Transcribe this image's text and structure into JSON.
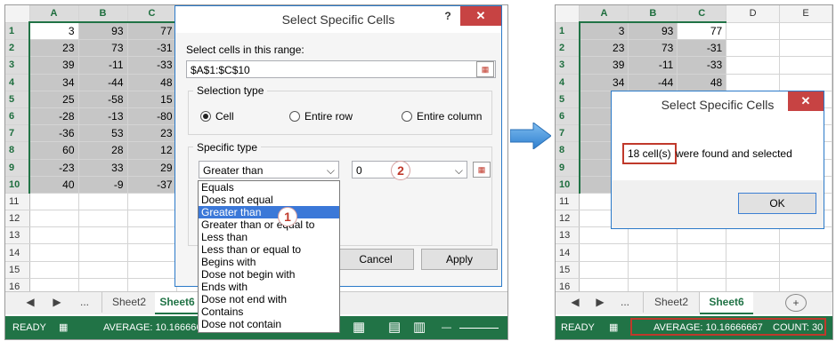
{
  "left": {
    "columns": [
      "A",
      "B",
      "C"
    ],
    "rows": [
      {
        "n": "1",
        "a": "3",
        "b": "93",
        "c": "77"
      },
      {
        "n": "2",
        "a": "23",
        "b": "73",
        "c": "-31"
      },
      {
        "n": "3",
        "a": "39",
        "b": "-11",
        "c": "-33"
      },
      {
        "n": "4",
        "a": "34",
        "b": "-44",
        "c": "48"
      },
      {
        "n": "5",
        "a": "25",
        "b": "-58",
        "c": "15"
      },
      {
        "n": "6",
        "a": "-28",
        "b": "-13",
        "c": "-80"
      },
      {
        "n": "7",
        "a": "-36",
        "b": "53",
        "c": "23"
      },
      {
        "n": "8",
        "a": "60",
        "b": "28",
        "c": "12"
      },
      {
        "n": "9",
        "a": "-23",
        "b": "33",
        "c": "29"
      },
      {
        "n": "10",
        "a": "40",
        "b": "-9",
        "c": "-37"
      },
      {
        "n": "11",
        "a": "",
        "b": "",
        "c": ""
      },
      {
        "n": "12",
        "a": "",
        "b": "",
        "c": ""
      },
      {
        "n": "13",
        "a": "",
        "b": "",
        "c": ""
      },
      {
        "n": "14",
        "a": "",
        "b": "",
        "c": ""
      },
      {
        "n": "15",
        "a": "",
        "b": "",
        "c": ""
      },
      {
        "n": "16",
        "a": "",
        "b": "",
        "c": ""
      }
    ],
    "tabs": {
      "ellipsis": "...",
      "sheet2": "Sheet2",
      "sheet6": "Sheet6"
    },
    "status": {
      "ready": "READY",
      "average": "AVERAGE: 10.16666667"
    }
  },
  "dialog": {
    "title": "Select Specific Cells",
    "help": "?",
    "close": "✕",
    "range_label": "Select cells in this range:",
    "range_value": "$A$1:$C$10",
    "selection_type_label": "Selection type",
    "radio_cell": "Cell",
    "radio_entire_row": "Entire row",
    "radio_entire_column": "Entire column",
    "specific_type_label": "Specific type",
    "type_value": "Greater than",
    "value_field": "0",
    "options": [
      "Equals",
      "Does not equal",
      "Greater than",
      "Greater than or equal to",
      "Less than",
      "Less than or equal to",
      "Begins with",
      "Dose not begin with",
      "Ends with",
      "Dose not end with",
      "Contains",
      "Dose not contain"
    ],
    "cancel": "Cancel",
    "apply": "Apply",
    "badge1": "1",
    "badge2": "2"
  },
  "right": {
    "columns": [
      "A",
      "B",
      "C",
      "D",
      "E"
    ],
    "rows": [
      {
        "n": "1",
        "a": "3",
        "b": "93",
        "c": "77"
      },
      {
        "n": "2",
        "a": "23",
        "b": "73",
        "c": "-31"
      },
      {
        "n": "3",
        "a": "39",
        "b": "-11",
        "c": "-33"
      },
      {
        "n": "4",
        "a": "34",
        "b": "-44",
        "c": "48"
      },
      {
        "n": "5",
        "a": "",
        "b": "",
        "c": ""
      },
      {
        "n": "6",
        "a": "",
        "b": "",
        "c": ""
      },
      {
        "n": "7",
        "a": "",
        "b": "",
        "c": ""
      },
      {
        "n": "8",
        "a": "",
        "b": "",
        "c": ""
      },
      {
        "n": "9",
        "a": "",
        "b": "",
        "c": ""
      },
      {
        "n": "10",
        "a": "",
        "b": "",
        "c": ""
      },
      {
        "n": "11",
        "a": "",
        "b": "",
        "c": ""
      },
      {
        "n": "12",
        "a": "",
        "b": "",
        "c": ""
      },
      {
        "n": "13",
        "a": "",
        "b": "",
        "c": ""
      },
      {
        "n": "14",
        "a": "",
        "b": "",
        "c": ""
      },
      {
        "n": "15",
        "a": "",
        "b": "",
        "c": ""
      },
      {
        "n": "16",
        "a": "",
        "b": "",
        "c": ""
      }
    ],
    "tabs": {
      "ellipsis": "...",
      "sheet2": "Sheet2",
      "sheet6": "Sheet6",
      "add": "+"
    },
    "status": {
      "ready": "READY",
      "average": "AVERAGE: 10.16666667",
      "count": "COUNT: 30"
    },
    "msg_title": "Select Specific Cells",
    "msg_close": "✕",
    "msg_count": "18 cell(s)",
    "msg_rest": " were found and selected",
    "msg_ok": "OK"
  },
  "arrow_color": "#3b8fd6",
  "accent": "#217346"
}
